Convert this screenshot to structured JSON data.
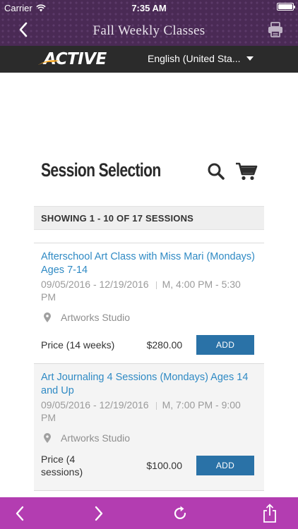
{
  "status_bar": {
    "carrier": "Carrier",
    "time": "7:35 AM"
  },
  "nav": {
    "title": "Fall Weekly Classes",
    "back_icon": "chevron-left-icon",
    "print_icon": "printer-icon"
  },
  "brand": {
    "logo_text": "ACTIVE",
    "language": "English (United Sta..."
  },
  "page": {
    "title": "Session Selection",
    "search_icon": "search-icon",
    "cart_icon": "cart-icon",
    "showing_text": "SHOWING 1 - 10 OF 17 SESSIONS"
  },
  "sessions": [
    {
      "title": "Afterschool Art Class with Miss Mari (Mondays) Ages 7-14",
      "date_range": "09/05/2016 - 12/19/2016",
      "schedule": "M, 4:00 PM - 5:30 PM",
      "location": "Artworks Studio",
      "price_label": "Price (14 weeks)",
      "price": "$280.00",
      "add_label": "ADD"
    },
    {
      "title": "Art Journaling 4 Sessions (Mondays) Ages 14 and Up",
      "date_range": "09/05/2016 - 12/19/2016",
      "schedule": "M, 7:00 PM - 9:00 PM",
      "location": "Artworks Studio",
      "price_label": "Price (4 sessions)",
      "price": "$100.00",
      "add_label": "ADD"
    }
  ],
  "toolbar": {
    "back_icon": "arrow-left-icon",
    "forward_icon": "arrow-right-icon",
    "reload_icon": "reload-icon",
    "share_icon": "share-icon"
  },
  "colors": {
    "header_purple": "#4a2a55",
    "brand_bar": "#2b2b2b",
    "link_blue": "#2f8ac4",
    "button_blue": "#2a72a7",
    "toolbar_magenta": "#b33db1"
  }
}
